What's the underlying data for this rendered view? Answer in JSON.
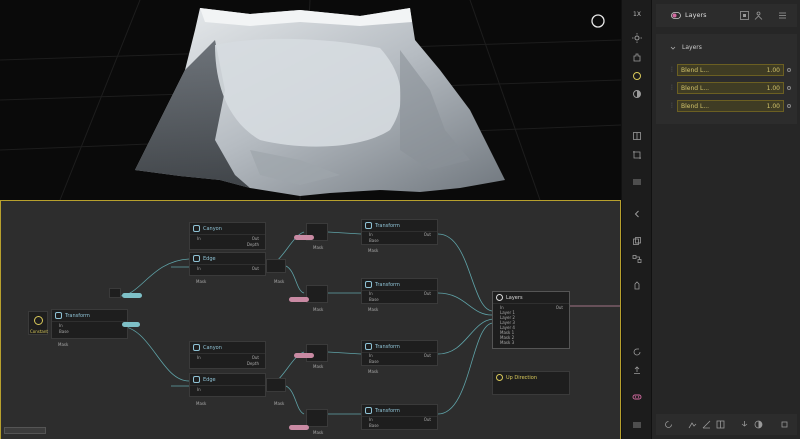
{
  "viewport": {
    "zoom_badge": "1X"
  },
  "right_panel": {
    "title": "Layers",
    "section_title": "Layers",
    "layers": [
      {
        "name": "Blend L...",
        "value": "1.00",
        "level": 1.0
      },
      {
        "name": "Blend L...",
        "value": "1.00",
        "level": 1.0
      },
      {
        "name": "Blend L...",
        "value": "1.00",
        "level": 1.0
      }
    ]
  },
  "graph": {
    "nodes": {
      "canyon_top": {
        "title": "Canyon",
        "in": "In",
        "out": "Out",
        "depth": "Depth",
        "mask": "Mask"
      },
      "edge_top": {
        "title": "Edge",
        "in": "In",
        "out": "Out",
        "mask": "Mask",
        "mask_right": "Mask"
      },
      "canyon_bottom": {
        "title": "Canyon",
        "in": "In",
        "out": "Out",
        "depth": "Depth",
        "mask": "Mask"
      },
      "edge_bottom": {
        "title": "Edge",
        "in": "In",
        "out": "Out",
        "mask": "Mask",
        "mask_right": "Mask"
      },
      "transform_left": {
        "title": "Transform",
        "in": "In",
        "base": "Base",
        "mask": "Mask"
      },
      "constant": {
        "title": "Constant"
      },
      "transform_1": {
        "title": "Transform",
        "in": "In",
        "base": "Base",
        "out": "Out",
        "mask": "Mask"
      },
      "transform_2": {
        "title": "Transform",
        "in": "In",
        "base": "Base",
        "out": "Out",
        "mask": "Mask"
      },
      "transform_3": {
        "title": "Transform",
        "in": "In",
        "base": "Base",
        "out": "Out",
        "mask": "Mask"
      },
      "transform_4": {
        "title": "Transform",
        "in": "In",
        "base": "Base",
        "out": "Out"
      },
      "layers": {
        "title": "Layers",
        "in": "In",
        "out": "Out",
        "ports": [
          "Layer 1",
          "Layer 2",
          "Layer 3",
          "Layer 4",
          "Mask 1",
          "Mask 2",
          "Mask 3"
        ]
      },
      "up_direction": {
        "title": "Up Direction"
      }
    },
    "mask_small_labels": {
      "m1": "Mask",
      "m2": "Mask",
      "m3": "Mask",
      "m4": "Mask"
    }
  },
  "colors": {
    "accent": "#d9c95a",
    "selection_border": "#b7a02d",
    "wire": "#5fa3a8",
    "pink_wire": "#c98aa3",
    "node_title": "#8fc3d6"
  },
  "icons": {
    "viewport_toolbar": [
      "zoom-badge",
      "sun-icon",
      "hand-icon",
      "sphere-icon",
      "half-circle-icon",
      "split-panel-icon",
      "crop-icon",
      "menu-icon"
    ],
    "graph_toolbar": [
      "chevron-left-icon",
      "copy-icon",
      "flow-icon",
      "hand-pointer-icon",
      "rotate-icon",
      "upload-icon",
      "gamepad-icon",
      "list-icon"
    ],
    "right_toolbar": [
      "toggle-icon",
      "panel-icon",
      "person-icon",
      "hamburger-icon"
    ]
  }
}
